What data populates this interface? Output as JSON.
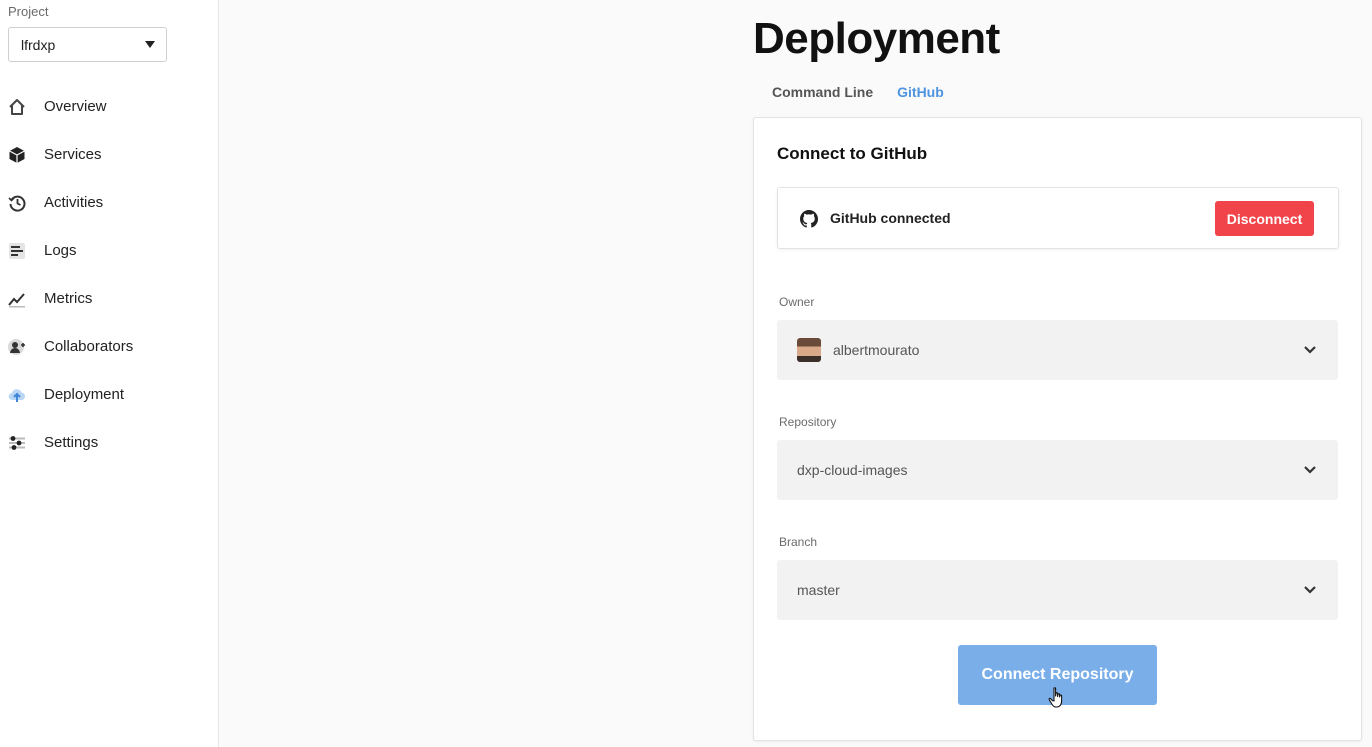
{
  "sidebar": {
    "project_label": "Project",
    "project_value": "lfrdxp",
    "items": [
      {
        "label": "Overview",
        "icon": "home-icon"
      },
      {
        "label": "Services",
        "icon": "cube-icon"
      },
      {
        "label": "Activities",
        "icon": "history-icon"
      },
      {
        "label": "Logs",
        "icon": "logs-icon"
      },
      {
        "label": "Metrics",
        "icon": "chart-icon"
      },
      {
        "label": "Collaborators",
        "icon": "add-user-icon"
      },
      {
        "label": "Deployment",
        "icon": "cloud-upload-icon"
      },
      {
        "label": "Settings",
        "icon": "sliders-icon"
      }
    ],
    "active_item": "Deployment"
  },
  "main": {
    "title": "Deployment",
    "tabs": [
      {
        "label": "Command Line",
        "active": false
      },
      {
        "label": "GitHub",
        "active": true
      }
    ],
    "card": {
      "title": "Connect to GitHub",
      "github_status": "GitHub connected",
      "disconnect_label": "Disconnect",
      "owner": {
        "label": "Owner",
        "value": "albertmourato"
      },
      "repository": {
        "label": "Repository",
        "value": "dxp-cloud-images"
      },
      "branch": {
        "label": "Branch",
        "value": "master"
      },
      "connect_label": "Connect Repository"
    }
  },
  "colors": {
    "accent": "#4d94e0",
    "danger": "#f0444a",
    "button_primary": "#79aee9"
  }
}
